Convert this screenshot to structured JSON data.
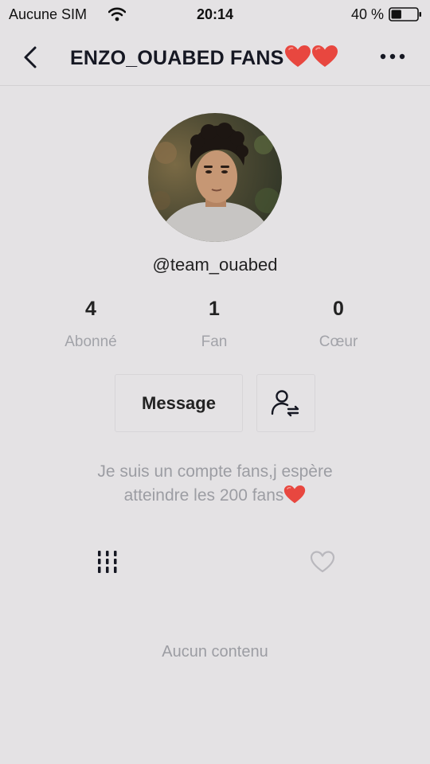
{
  "status_bar": {
    "carrier": "Aucune SIM",
    "time": "20:14",
    "battery": "40 %",
    "battery_level": 0.4
  },
  "nav": {
    "title": "ENZO_OUABED FANS",
    "title_suffix_icons": [
      "red-heart-emoji",
      "red-heart-emoji"
    ],
    "back_icon": "chevron-left-icon",
    "more_icon": "more-horizontal-icon"
  },
  "profile": {
    "username": "@team_ouabed",
    "stats": [
      {
        "value": "4",
        "label": "Abonné"
      },
      {
        "value": "1",
        "label": "Fan"
      },
      {
        "value": "0",
        "label": "Cœur"
      }
    ],
    "message_button": "Message",
    "follow_icon": "user-switch-icon",
    "bio_line1": "Je suis un compte fans,j espère",
    "bio_line2": "atteindre les 200 fans",
    "bio_emoji": "red-heart-emoji"
  },
  "tabs": {
    "videos_icon": "grid-lines-icon",
    "liked_icon": "heart-outline-icon"
  },
  "empty_state": "Aucun contenu",
  "colors": {
    "background": "#e4e2e4",
    "text_primary": "#161823",
    "text_secondary": "#a2a3a9",
    "heart_red": "#e8473f"
  }
}
